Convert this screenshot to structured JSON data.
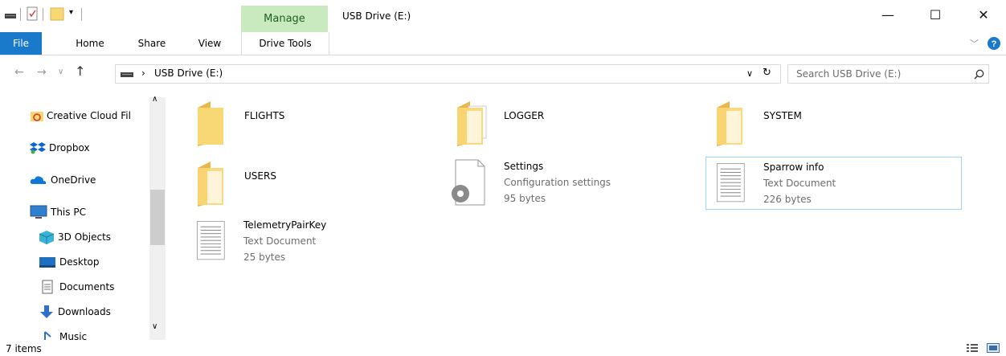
{
  "window": {
    "title": "USB Drive (E:)",
    "context_tab": "Manage",
    "controls": {
      "minimize": "—",
      "maximize": "☐",
      "close": "✕"
    }
  },
  "ribbon": {
    "tabs": [
      "File",
      "Home",
      "Share",
      "View",
      "Drive Tools"
    ]
  },
  "address": {
    "path_segments": [
      "USB Drive (E:)"
    ],
    "search_placeholder": "Search USB Drive (E:)"
  },
  "nav": {
    "items": [
      {
        "label": "Creative Cloud Fil",
        "icon": "creative-cloud-icon"
      },
      {
        "label": "Dropbox",
        "icon": "dropbox-icon"
      },
      {
        "label": "OneDrive",
        "icon": "onedrive-icon"
      },
      {
        "label": "This PC",
        "icon": "pc-icon"
      },
      {
        "label": "3D Objects",
        "icon": "3d-objects-icon"
      },
      {
        "label": "Desktop",
        "icon": "desktop-icon"
      },
      {
        "label": "Documents",
        "icon": "documents-icon"
      },
      {
        "label": "Downloads",
        "icon": "downloads-icon"
      },
      {
        "label": "Music",
        "icon": "music-icon"
      }
    ]
  },
  "files": [
    {
      "name": "FLIGHTS",
      "kind": "folder"
    },
    {
      "name": "LOGGER",
      "kind": "folder"
    },
    {
      "name": "SYSTEM",
      "kind": "folder"
    },
    {
      "name": "USERS",
      "kind": "folder"
    },
    {
      "name": "Settings",
      "type": "Configuration settings",
      "size": "95 bytes",
      "kind": "config"
    },
    {
      "name": "Sparrow info",
      "type": "Text Document",
      "size": "226 bytes",
      "kind": "text",
      "selected": true
    },
    {
      "name": "TelemetryPairKey",
      "type": "Text Document",
      "size": "25 bytes",
      "kind": "text"
    }
  ],
  "status": {
    "item_count": "7 items"
  },
  "colors": {
    "file_tab": "#1979ca",
    "manage_tab": "#c9e9bf",
    "selected_border": "#99d1ff",
    "folder": "#f8d775"
  }
}
